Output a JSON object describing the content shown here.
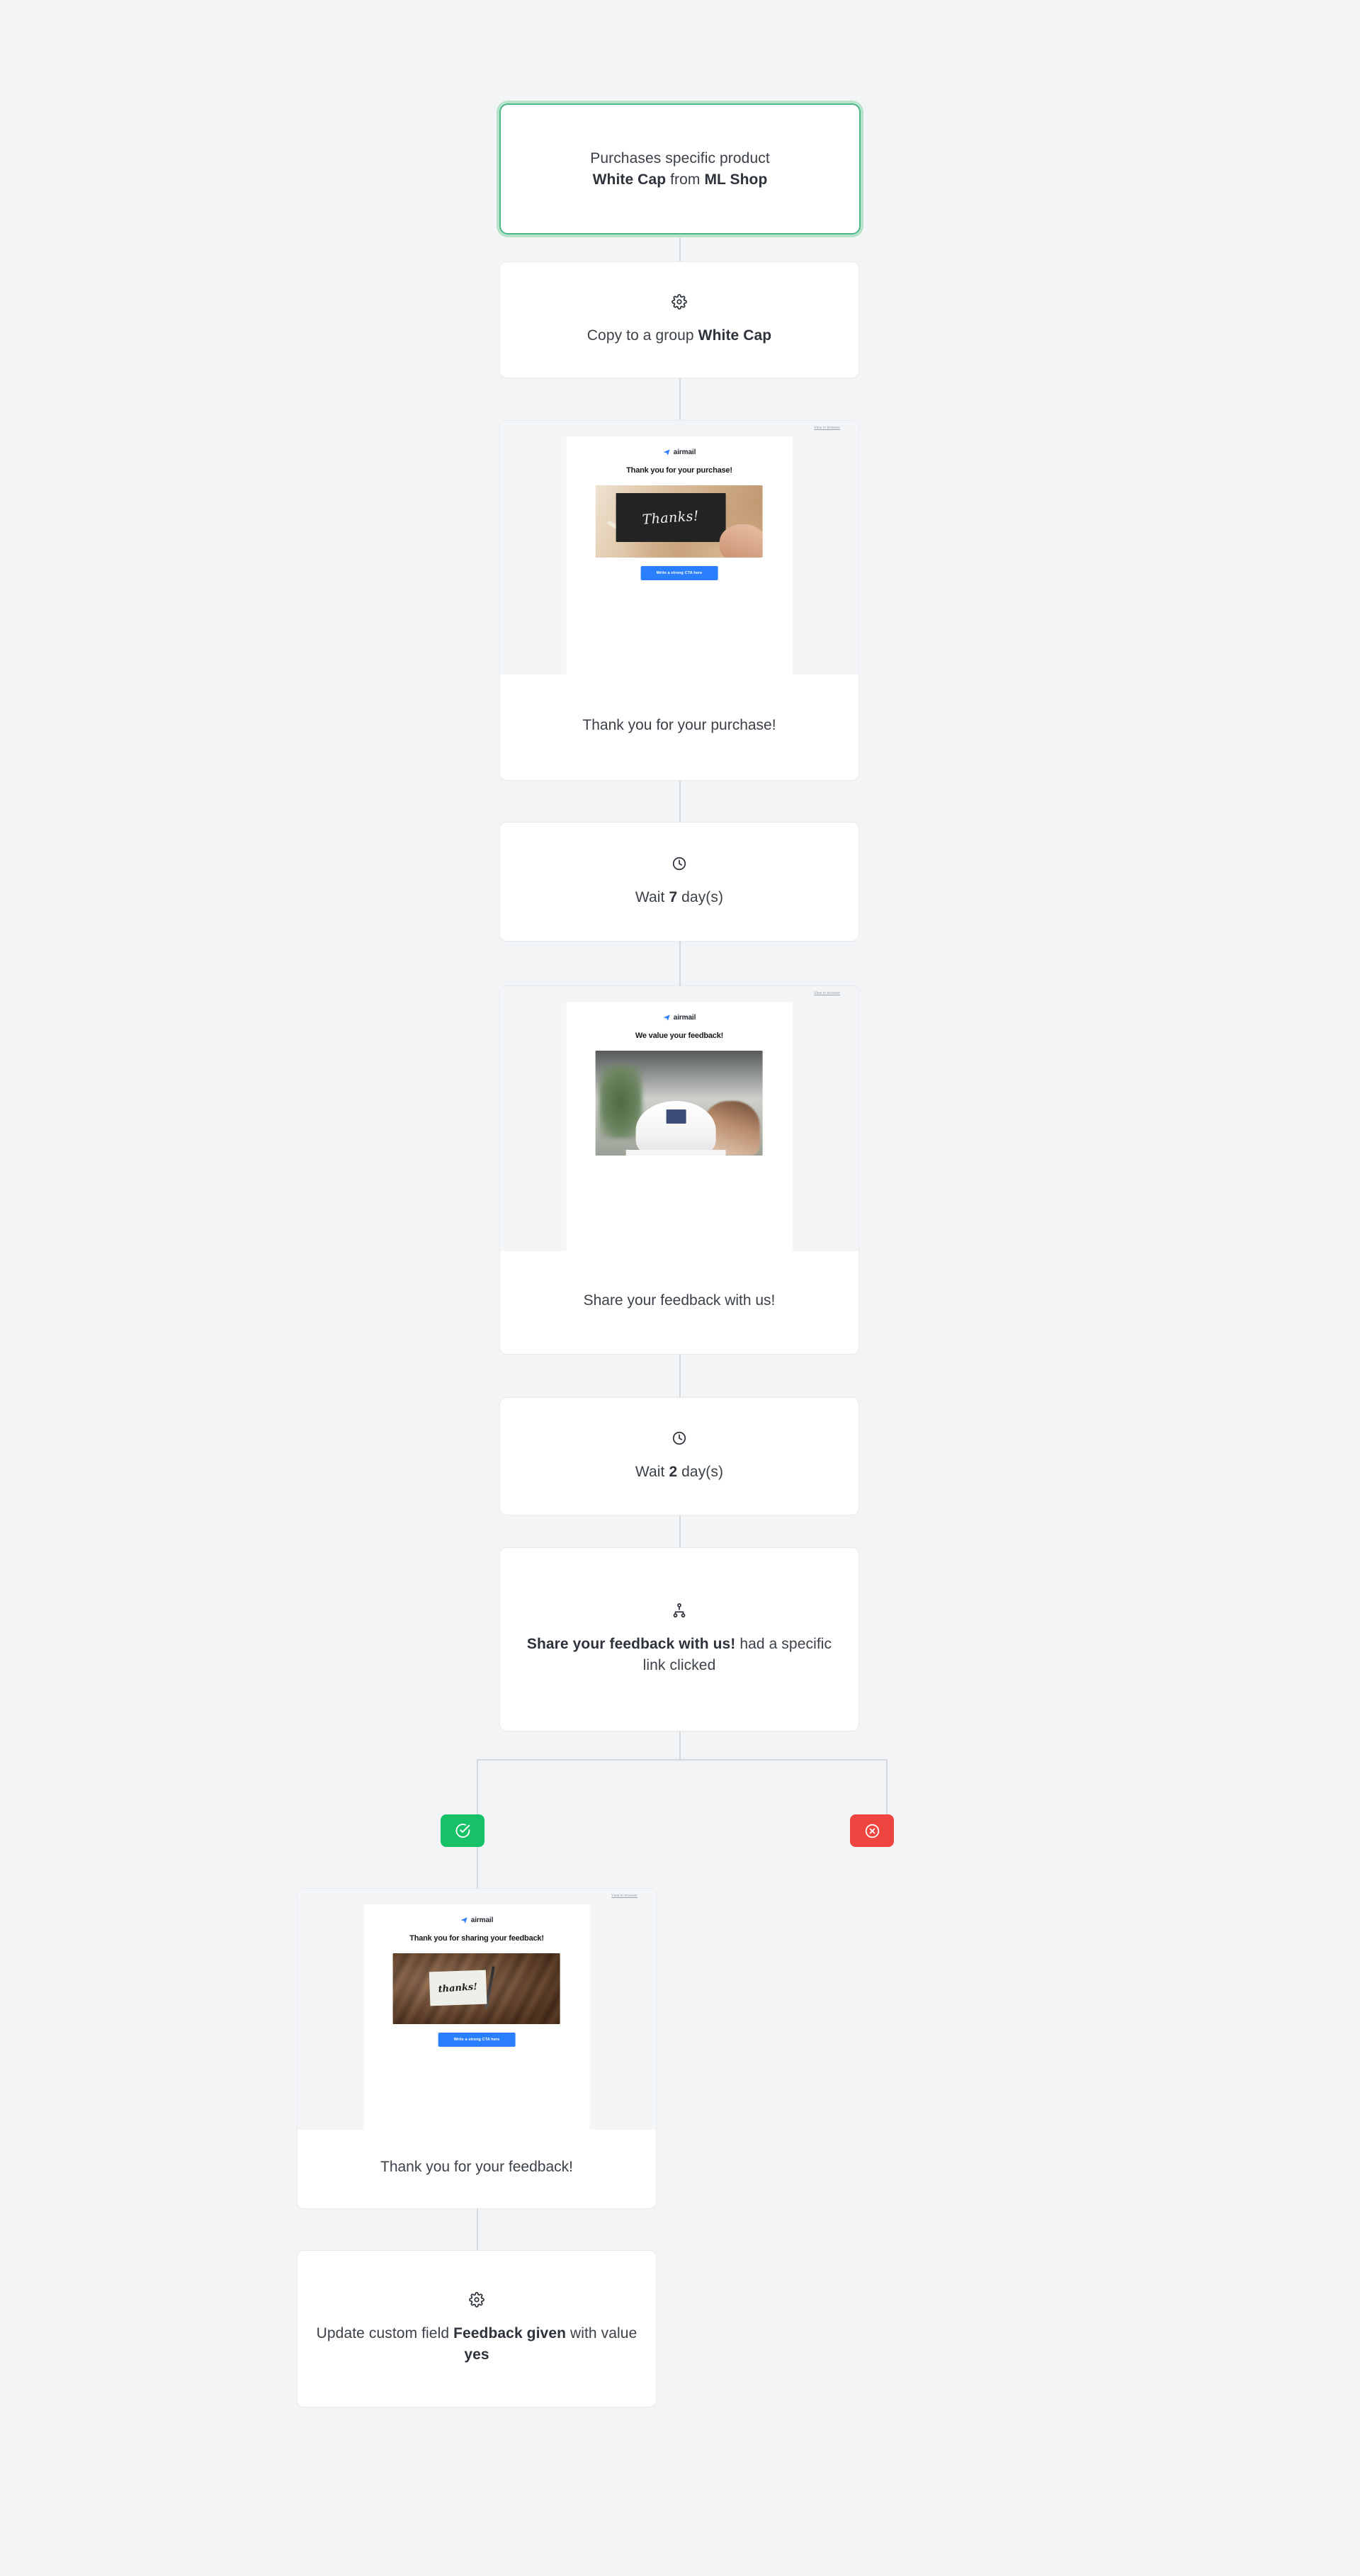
{
  "theme": {
    "background": "#f3f4f6",
    "card_background": "#ffffff",
    "card_border": "#e7eaee",
    "connector": "#d5d9de",
    "trigger_border": "#4cba87",
    "trigger_glow": "#b7e3cd",
    "yes_branch": "#16c168",
    "no_branch": "#ef4540",
    "cta_blue": "#2a7fff",
    "text": "#3c4149"
  },
  "email_template": {
    "view_in_browser": "View in browser",
    "brand_name": "airmail",
    "cta_label": "Write a strong CTA here"
  },
  "workflow": {
    "trigger": {
      "icon": "",
      "text_line1": "Purchases specific product",
      "text_line2_bold_a": "White Cap",
      "text_line2_mid": " from ",
      "text_line2_bold_b": "ML Shop"
    },
    "nodes": [
      {
        "id": "copy-to-group",
        "type": "action",
        "icon": "gear-icon",
        "text_prefix": "Copy to a group ",
        "text_bold": "White Cap",
        "text_suffix": ""
      },
      {
        "id": "email-thank-you-purchase",
        "type": "email",
        "heading": "Thank you for your purchase!",
        "hero": "chalkboard-thanks",
        "hero_word": "Thanks!",
        "caption": "Thank you for your purchase!"
      },
      {
        "id": "wait-7-days",
        "type": "wait",
        "icon": "clock-icon",
        "text_prefix": "Wait ",
        "text_bold": "7",
        "text_suffix": " day(s)"
      },
      {
        "id": "email-value-feedback",
        "type": "email",
        "heading": "We value your feedback!",
        "hero": "white-cap-photo",
        "hero_word": "",
        "caption": "Share your feedback with us!"
      },
      {
        "id": "wait-2-days",
        "type": "wait",
        "icon": "clock-icon",
        "text_prefix": "Wait ",
        "text_bold": "2",
        "text_suffix": " day(s)"
      },
      {
        "id": "condition-link-clicked",
        "type": "condition",
        "icon": "branch-icon",
        "text_bold": "Share your feedback with us!",
        "text_suffix": " had a specific link clicked"
      }
    ],
    "branches": {
      "yes": {
        "icon": "check-circle-icon",
        "label": "Yes"
      },
      "no": {
        "icon": "x-circle-icon",
        "label": "No"
      }
    },
    "yes_path": [
      {
        "id": "email-thanks-for-sharing",
        "type": "email",
        "heading": "Thank you for sharing your feedback!",
        "hero": "wood-thanks-note",
        "hero_word": "thanks!",
        "caption": "Thank you for your feedback!"
      },
      {
        "id": "update-custom-field",
        "type": "action",
        "icon": "gear-icon",
        "text_prefix": "Update custom field ",
        "text_bold": "Feedback given",
        "text_mid": " with value ",
        "text_bold2": "yes"
      }
    ]
  }
}
